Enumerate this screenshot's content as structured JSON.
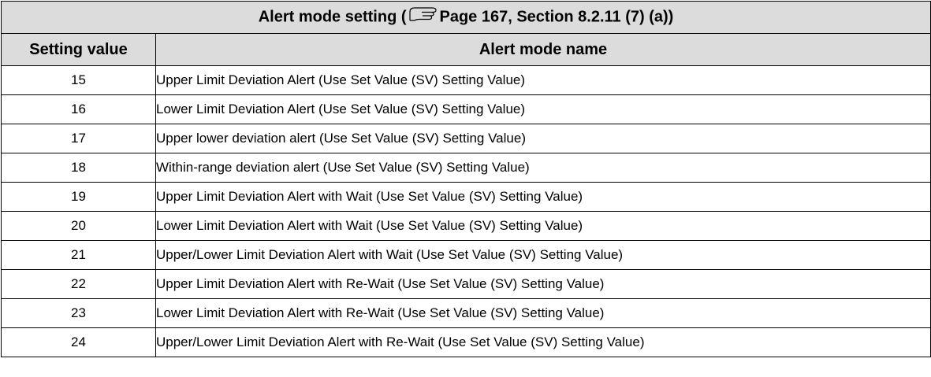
{
  "table": {
    "title_prefix": "Alert mode setting (",
    "title_reference": "Page 167, Section 8.2.11 (7) (a))",
    "reference_icon": "pointing-hand-icon",
    "headers": {
      "value": "Setting value",
      "name": "Alert mode name"
    },
    "rows": [
      {
        "value": "15",
        "name": "Upper Limit Deviation Alert (Use Set Value (SV) Setting Value)"
      },
      {
        "value": "16",
        "name": "Lower Limit Deviation Alert (Use Set Value (SV) Setting Value)"
      },
      {
        "value": "17",
        "name": "Upper lower deviation alert (Use Set Value (SV) Setting Value)"
      },
      {
        "value": "18",
        "name": "Within-range deviation alert (Use Set Value (SV) Setting Value)"
      },
      {
        "value": "19",
        "name": "Upper Limit Deviation Alert with Wait (Use Set Value (SV) Setting Value)"
      },
      {
        "value": "20",
        "name": "Lower Limit Deviation Alert with Wait (Use Set Value (SV) Setting Value)"
      },
      {
        "value": "21",
        "name": "Upper/Lower Limit Deviation Alert with Wait (Use Set Value (SV) Setting Value)"
      },
      {
        "value": "22",
        "name": "Upper Limit Deviation Alert with Re-Wait (Use Set Value (SV) Setting Value)"
      },
      {
        "value": "23",
        "name": "Lower Limit Deviation Alert with Re-Wait (Use Set Value (SV) Setting Value)"
      },
      {
        "value": "24",
        "name": "Upper/Lower Limit Deviation Alert with Re-Wait (Use Set Value (SV) Setting Value)"
      }
    ]
  }
}
